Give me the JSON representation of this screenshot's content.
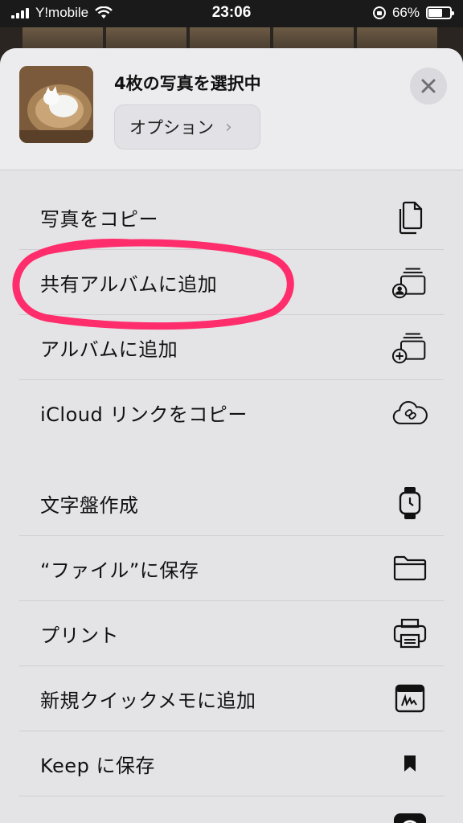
{
  "status_bar": {
    "carrier": "Y!mobile",
    "time": "23:06",
    "battery_percent_label": "66%",
    "battery_level": 0.66
  },
  "sheet": {
    "title": "4枚の写真を選択中",
    "options_label": "オプション",
    "close_icon": "close-icon"
  },
  "actions_group_1": [
    {
      "label": "写真をコピー",
      "icon": "copy-icon"
    },
    {
      "label": "共有アルバムに追加",
      "icon": "shared-album-icon"
    },
    {
      "label": "アルバムに追加",
      "icon": "add-album-icon"
    },
    {
      "label": "iCloud リンクをコピー",
      "icon": "icloud-link-icon"
    }
  ],
  "actions_group_2": [
    {
      "label": "文字盤作成",
      "icon": "watch-icon"
    },
    {
      "label": "“ファイル”に保存",
      "icon": "folder-icon"
    },
    {
      "label": "プリント",
      "icon": "printer-icon"
    },
    {
      "label": "新規クイックメモに追加",
      "icon": "quick-note-icon"
    },
    {
      "label": "Keep に保存",
      "icon": "bookmark-icon"
    }
  ],
  "colors": {
    "highlight": "#ff2d6b",
    "sheet_background": "#e4e4e6"
  }
}
